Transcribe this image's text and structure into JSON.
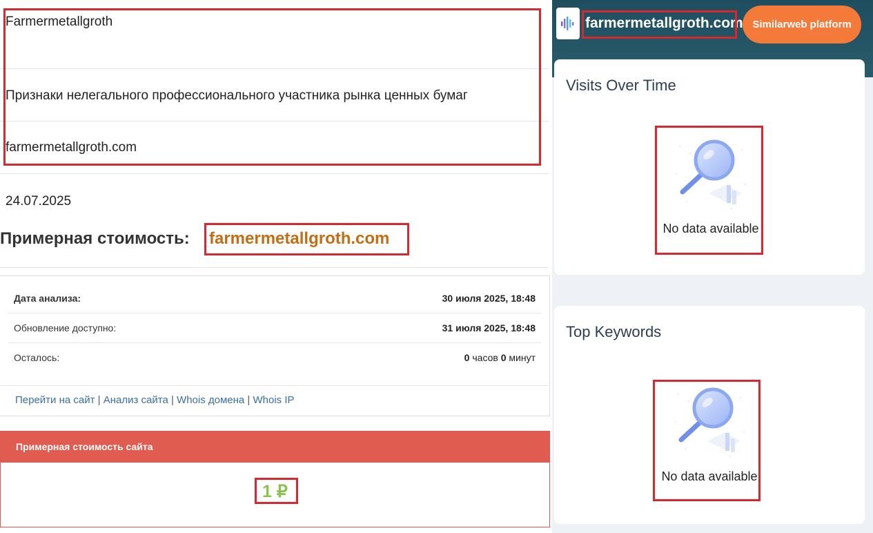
{
  "left": {
    "rows": [
      "Farmermetallgroth",
      "Признаки нелегального профессионального участника рынка ценных бумаг",
      "farmermetallgroth.com"
    ],
    "date": "24.07.2025",
    "price_title": "Примерная стоимость:",
    "price_domain": "farmermetallgroth.com",
    "analysis": [
      {
        "key": "Дата анализа:",
        "value": "30 июля 2025, 18:48"
      },
      {
        "key": "Обновление доступно:",
        "value": "31 июля 2025, 18:48"
      },
      {
        "key": "Осталось:",
        "hours": "0",
        "hours_label": "часов",
        "minutes": "0",
        "minutes_label": "минут"
      }
    ],
    "links": [
      "Перейти на сайт",
      "Анализ сайта",
      "Whois домена",
      "Whois IP"
    ],
    "link_sep": " | ",
    "estimate_title": "Примерная стоимость сайта",
    "estimate_value": "1 ₽"
  },
  "right": {
    "domain": "farmermetallgroth.com",
    "platform_button": "Similarweb platform",
    "cards": [
      {
        "title": "Visits Over Time",
        "empty_text": "No data available"
      },
      {
        "title": "Top Keywords",
        "empty_text": "No data available"
      }
    ]
  },
  "colors": {
    "highlight": "#d7282f",
    "accent_orange": "#f47a3a",
    "estimate_red": "#e05c50",
    "value_green": "#8cc152",
    "domain_brown": "#c46d12"
  }
}
